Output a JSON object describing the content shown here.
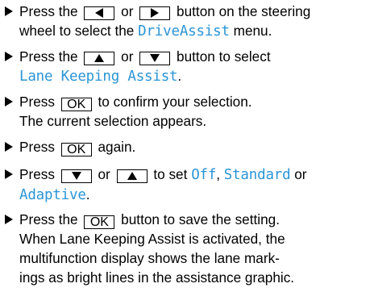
{
  "colors": {
    "menu_text": "#2b95d6",
    "text": "#000000"
  },
  "icons": {
    "bullet": "right-triangle-bullet",
    "left_key": "left-arrow-key",
    "right_key": "right-arrow-key",
    "up_key": "up-arrow-key",
    "down_key": "down-arrow-key"
  },
  "steps": {
    "s1": {
      "a": "Press the",
      "b": "or",
      "c": "button on the steering",
      "d": "wheel to select the",
      "menu": "DriveAssist",
      "e": "menu."
    },
    "s2": {
      "a": "Press the",
      "b": "or",
      "c": "button to select",
      "menu": "Lane Keeping Assist",
      "e": "."
    },
    "s3": {
      "a": "Press",
      "key": "OK",
      "b": "to confirm your selection.",
      "c": "The current selection appears."
    },
    "s4": {
      "a": "Press",
      "key": "OK",
      "b": "again."
    },
    "s5": {
      "a": "Press",
      "b": "or",
      "c": "to set",
      "off": "Off",
      "comma": ",",
      "standard": "Standard",
      "d": "or",
      "adaptive": "Adaptive",
      "e": "."
    },
    "s6": {
      "a": "Press the",
      "key": "OK",
      "b": "button to save the setting.",
      "c": "When Lane Keeping Assist is activated, the",
      "d": "multifunction display shows the lane mark-",
      "e": "ings as bright lines in the assistance graphic."
    }
  }
}
